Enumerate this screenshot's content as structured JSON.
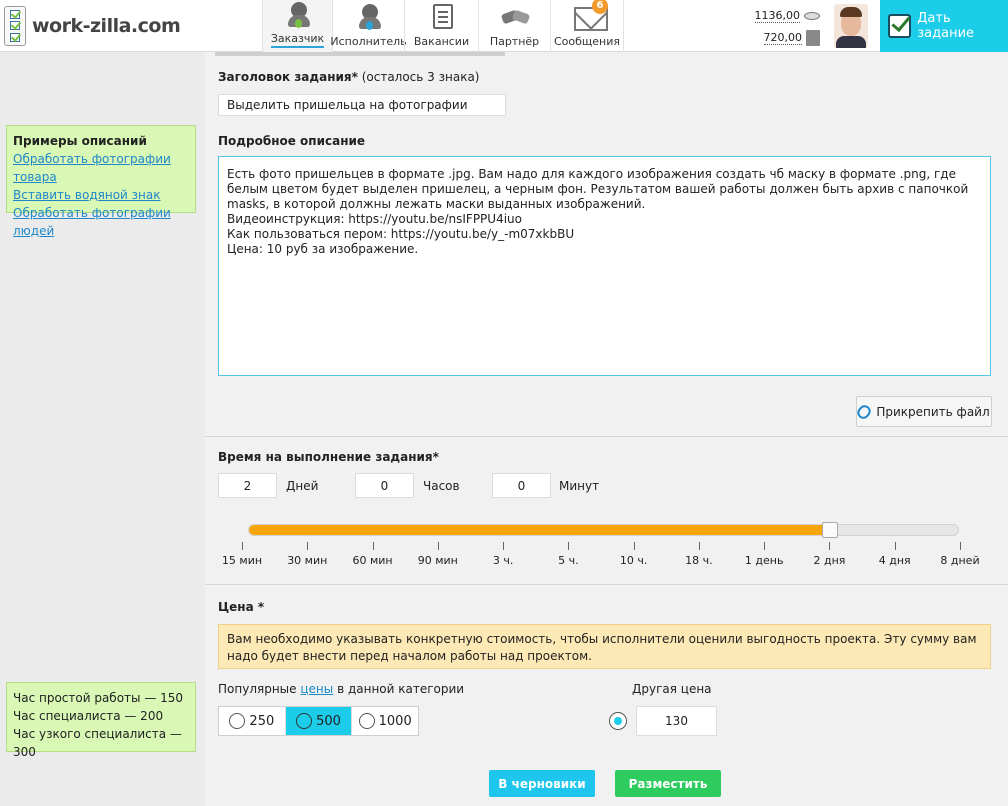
{
  "header": {
    "logo_text": "work-zilla.com",
    "nav": [
      {
        "label": "Заказчик",
        "icon": "customer-icon",
        "active": true
      },
      {
        "label": "Исполнитель",
        "icon": "freelancer-icon",
        "active": false
      },
      {
        "label": "Вакансии",
        "icon": "vacancies-icon",
        "active": false
      },
      {
        "label": "Партнёр",
        "icon": "partner-handshake-icon",
        "active": false
      },
      {
        "label": "Сообщения",
        "icon": "messages-envelope-icon",
        "active": false,
        "badge": "6"
      }
    ],
    "balance_main": "1136,00",
    "balance_bonus": "720,00",
    "cta_label": "Дать задание"
  },
  "sidebar": {
    "examples_title": "Примеры описаний",
    "examples": [
      "Обработать фотографии товара",
      "Вставить водяной знак",
      "Обработать фотографии людей"
    ],
    "rates": [
      "Час простой работы — 150",
      "Час специалиста — 200",
      "Час узкого специалиста — 300"
    ]
  },
  "form": {
    "title_label": "Заголовок задания*",
    "title_hint": "(осталось 3 знака)",
    "title_value": "Выделить пришельца на фотографии",
    "desc_label": "Подробное описание",
    "desc_value": "Есть фото пришельцев в формате .jpg. Вам надо для каждого изображения создать чб маску в формате .png, где белым цветом будет выделен пришелец, а черным фон. Результатом вашей работы должен быть архив с папочкой masks, в которой должны лежать маски выданных изображений.\nВидеоинструкция: https://youtu.be/nsIFPPU4iuo\nКак пользоваться пером: https://youtu.be/y_-m07xkbBU\nЦена: 10 руб за изображение.",
    "attach_label": "Прикрепить файл",
    "time_label": "Время на выполнение задания*",
    "days_value": "2",
    "days_unit": "Дней",
    "hours_value": "0",
    "hours_unit": "Часов",
    "minutes_value": "0",
    "minutes_unit": "Минут",
    "slider": {
      "ticks": [
        "15 мин",
        "30 мин",
        "60 мин",
        "90 мин",
        "3 ч.",
        "5 ч.",
        "10 ч.",
        "18 ч.",
        "1 день",
        "2 дня",
        "4 дня",
        "8 дней"
      ],
      "selected_index": 9
    },
    "price_label": "Цена *",
    "price_notice": "Вам необходимо указывать конкретную стоимость, чтобы исполнители оценили выгодность проекта. Эту сумму вам надо будет внести перед началом работы над проектом.",
    "popular_prefix": "Популярные",
    "popular_link": "цены",
    "popular_suffix": "в данной категории",
    "popular_prices": [
      "250",
      "500",
      "1000"
    ],
    "popular_selected": 1,
    "other_price_label": "Другая цена",
    "other_price_value": "130",
    "draft_button": "В черновики",
    "publish_button": "Разместить"
  },
  "colors": {
    "accent": "#1ccde9",
    "slider_fill": "#f6a50b",
    "publish": "#2ecc5e",
    "draft": "#1ec5ec",
    "sidebar_bg": "#d9f7b5",
    "notice_bg": "#fde9b5"
  }
}
